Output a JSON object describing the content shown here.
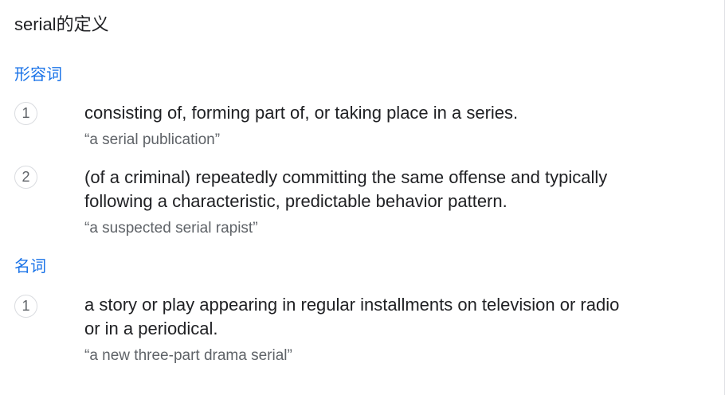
{
  "title": "serial的定义",
  "sections": [
    {
      "pos": "形容词",
      "senses": [
        {
          "number": "1",
          "definition": "consisting of, forming part of, or taking place in a series.",
          "example": "“a serial publication”"
        },
        {
          "number": "2",
          "definition_lines": [
            "(of a criminal) repeatedly committing the same offense and typically",
            "following a characteristic, predictable behavior pattern."
          ],
          "example": "“a suspected serial rapist”"
        }
      ]
    },
    {
      "pos": "名词",
      "senses": [
        {
          "number": "1",
          "definition_lines": [
            "a story or play appearing in regular installments on television or radio",
            "or in a periodical."
          ],
          "example": "“a new three-part drama serial”"
        }
      ]
    }
  ]
}
